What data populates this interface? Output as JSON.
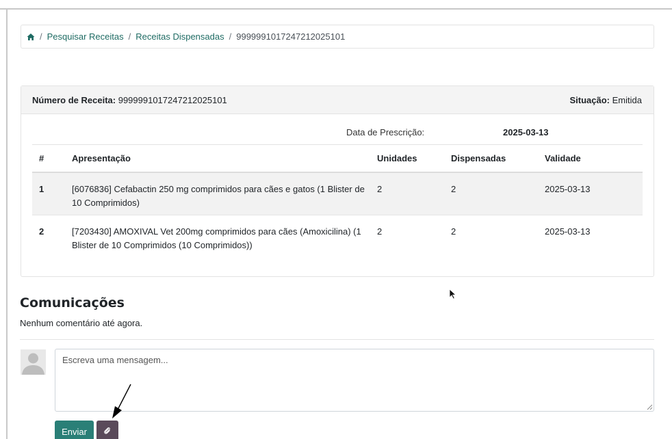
{
  "breadcrumb": {
    "home_icon": "home-icon",
    "items": [
      "Pesquisar Receitas",
      "Receitas Dispensadas"
    ],
    "separator": "/",
    "current": "9999991017247212025101"
  },
  "prescription": {
    "number_label": "Número de Receita:",
    "number_value": "9999991017247212025101",
    "status_label": "Situação:",
    "status_value": "Emitida",
    "prescription_date_label": "Data de Prescrição:",
    "prescription_date_value": "2025-03-13"
  },
  "table": {
    "headers": [
      "#",
      "Apresentação",
      "Unidades",
      "Dispensadas",
      "Validade"
    ],
    "rows": [
      {
        "num": "1",
        "presentation": "[6076836] Cefabactin 250 mg comprimidos para cães e gatos (1 Blister de 10 Comprimidos)",
        "units": "2",
        "dispensed": "2",
        "validity": "2025-03-13"
      },
      {
        "num": "2",
        "presentation": "[7203430] AMOXIVAL Vet 200mg comprimidos para cães (Amoxicilina) (1 Blister de 10 Comprimidos (10 Comprimidos))",
        "units": "2",
        "dispensed": "2",
        "validity": "2025-03-13"
      }
    ]
  },
  "communications": {
    "title": "Comunicações",
    "empty_text": "Nenhum comentário até agora.",
    "message_placeholder": "Escreva uma mensagem...",
    "send_label": "Enviar",
    "attach_icon": "paperclip-icon"
  },
  "colors": {
    "link": "#1e6b63",
    "send_button": "#2a7f77",
    "attach_button": "#5a4a5a"
  }
}
